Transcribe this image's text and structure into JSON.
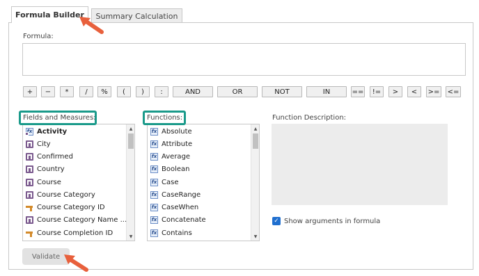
{
  "tabs": [
    {
      "label": "Formula Builder",
      "active": true
    },
    {
      "label": "Summary Calculation",
      "active": false
    }
  ],
  "formula": {
    "label": "Formula:",
    "value": ""
  },
  "operators": [
    "+",
    "−",
    "*",
    "/",
    "%",
    "(",
    ")",
    ":",
    "AND",
    "OR",
    "NOT",
    "IN",
    "==",
    "!=",
    ">",
    "<",
    ">=",
    "<="
  ],
  "fields": {
    "label": "Fields and Measures:",
    "items": [
      {
        "label": "Activity",
        "icon": "formula-dimension-icon",
        "bold": true
      },
      {
        "label": "City",
        "icon": "dimension-icon"
      },
      {
        "label": "Confirmed",
        "icon": "dimension-icon"
      },
      {
        "label": "Country",
        "icon": "dimension-icon"
      },
      {
        "label": "Course",
        "icon": "dimension-icon"
      },
      {
        "label": "Course Category",
        "icon": "dimension-icon"
      },
      {
        "label": "Course Category ID",
        "icon": "key-icon"
      },
      {
        "label": "Course Category Name ...",
        "icon": "dimension-icon"
      },
      {
        "label": "Course Completion ID",
        "icon": "key-icon"
      }
    ]
  },
  "functions": {
    "label": "Functions:",
    "items": [
      "Absolute",
      "Attribute",
      "Average",
      "Boolean",
      "Case",
      "CaseRange",
      "CaseWhen",
      "Concatenate",
      "Contains"
    ]
  },
  "description": {
    "label": "Function Description:",
    "text": ""
  },
  "show_args": {
    "label": "Show arguments in formula",
    "checked": true
  },
  "validate_label": "Validate",
  "colors": {
    "highlight": "#1a9a8a",
    "arrow": "#e8603c",
    "checkbox": "#1f6fcf"
  }
}
